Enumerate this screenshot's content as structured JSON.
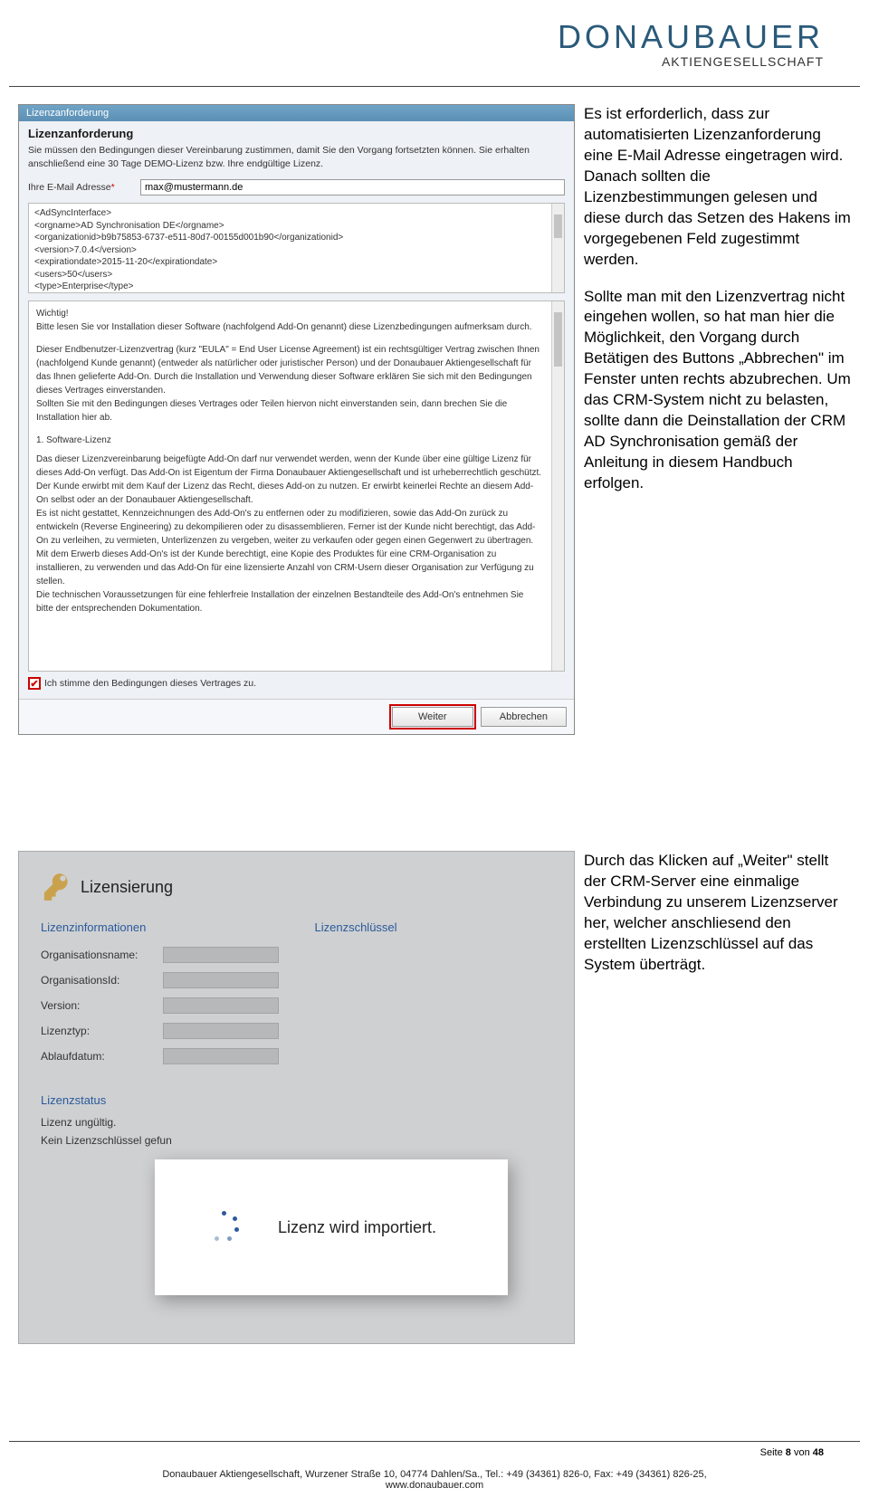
{
  "brand": {
    "name": "DONAUBAUER",
    "sub": "AKTIENGESELLSCHAFT"
  },
  "dialog1": {
    "title": "Lizenzanforderung",
    "heading": "Lizenzanforderung",
    "desc": "Sie müssen den Bedingungen dieser Vereinbarung zustimmen, damit Sie den Vorgang fortsetzten können. Sie erhalten anschließend eine 30 Tage DEMO-Lizenz bzw. Ihre endgültige Lizenz.",
    "email_label": "Ihre E-Mail Adresse",
    "email_value": "max@mustermann.de",
    "xml": {
      "l1": "<AdSyncInterface>",
      "l2": "    <orgname>AD Synchronisation DE</orgname>",
      "l3": "    <organizationid>b9b75853-6737-e511-80d7-00155d001b90</organizationid>",
      "l4": "    <version>7.0.4</version>",
      "l5": "    <expirationdate>2015-11-20</expirationdate>",
      "l6": "    <users>50</users>",
      "l7": "    <type>Enterprise</type>"
    },
    "eula": {
      "p1": "Wichtig!\nBitte lesen Sie vor Installation dieser Software (nachfolgend Add-On genannt) diese Lizenzbedingungen aufmerksam durch.",
      "p2": "Dieser Endbenutzer-Lizenzvertrag (kurz \"EULA\" = End User License Agreement) ist ein rechtsgültiger Vertrag zwischen Ihnen (nachfolgend Kunde genannt) (entweder als natürlicher oder juristischer Person) und der Donaubauer Aktiengesellschaft für das Ihnen gelieferte Add-On. Durch die Installation und Verwendung dieser Software erklären Sie sich mit den Bedingungen dieses Vertrages einverstanden.\nSollten Sie mit den Bedingungen dieses Vertrages oder Teilen hiervon nicht einverstanden sein, dann brechen Sie die Installation hier ab.",
      "p3": "1. Software-Lizenz",
      "p4": "Das dieser Lizenzvereinbarung beigefügte Add-On darf nur verwendet werden, wenn der Kunde über eine gültige Lizenz für dieses Add-On verfügt. Das Add-On ist Eigentum der Firma Donaubauer Aktiengesellschaft und ist urheberrechtlich geschützt. Der Kunde erwirbt mit dem Kauf der Lizenz das Recht, dieses Add-on zu nutzen. Er erwirbt keinerlei Rechte an diesem Add-On selbst oder an der Donaubauer Aktiengesellschaft.\nEs ist nicht gestattet, Kennzeichnungen des Add-On's zu entfernen oder zu modifizieren, sowie das Add-On zurück zu entwickeln (Reverse Engineering) zu dekompilieren oder zu disassemblieren. Ferner ist der Kunde nicht berechtigt, das Add-On zu verleihen, zu vermieten, Unterlizenzen zu vergeben, weiter zu verkaufen oder gegen einen Gegenwert zu übertragen.\nMit dem Erwerb dieses Add-On's ist der Kunde berechtigt, eine Kopie des Produktes für eine CRM-Organisation zu installieren, zu verwenden und das Add-On für eine lizensierte Anzahl von CRM-Usern dieser Organisation zur Verfügung zu stellen.\nDie technischen Voraussetzungen für eine fehlerfreie Installation der einzelnen Bestandteile des Add-On's entnehmen Sie bitte der entsprechenden Dokumentation."
    },
    "agree_label": "Ich stimme den Bedingungen dieses Vertrages zu.",
    "btn_continue": "Weiter",
    "btn_cancel": "Abbrechen"
  },
  "side1": {
    "p1": "Es ist erforderlich, dass zur automatisierten Lizenzanforderung eine E-Mail Adresse eingetragen wird.\nDanach sollten die Lizenzbestimmungen gelesen und diese durch das Setzen des Hakens im vorgegebenen Feld zugestimmt werden.",
    "p2": "Sollte man mit den Lizenzvertrag nicht eingehen wollen, so hat man hier die Möglichkeit, den Vorgang durch Betätigen des Buttons „Abbrechen\" im Fenster unten rechts abzubrechen. Um das CRM-System nicht zu belasten, sollte dann die Deinstallation der CRM AD Synchronisation gemäß der Anleitung in diesem Handbuch erfolgen."
  },
  "dialog2": {
    "title": "Lizensierung",
    "col1": "Lizenzinformationen",
    "col2": "Lizenzschlüssel",
    "fields": {
      "f1": "Organisationsname:",
      "f2": "OrganisationsId:",
      "f3": "Version:",
      "f4": "Lizenztyp:",
      "f5": "Ablaufdatum:"
    },
    "status_head": "Lizenzstatus",
    "status1": "Lizenz ungültig.",
    "status2": "Kein Lizenzschlüssel gefun",
    "modal_text": "Lizenz wird importiert."
  },
  "side2": {
    "p1": "Durch das Klicken auf „Weiter\" stellt der CRM-Server eine einmalige Verbindung zu unserem Lizenzserver her, welcher anschliesend den erstellten Lizenzschlüssel auf das System überträgt."
  },
  "page": {
    "label": "Seite ",
    "current": "8",
    "sep": " von ",
    "total": "48"
  },
  "footer": {
    "line1": "Donaubauer Aktiengesellschaft, Wurzener Straße 10, 04774 Dahlen/Sa., Tel.: +49 (34361) 826-0, Fax: +49 (34361) 826-25,",
    "line2": "www.donaubauer.com"
  }
}
